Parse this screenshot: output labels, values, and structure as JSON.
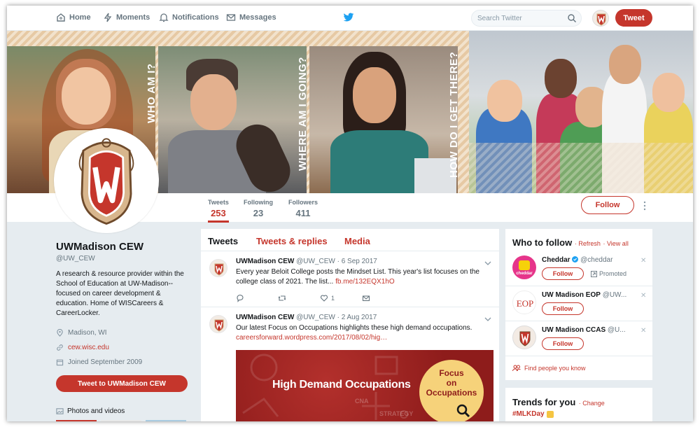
{
  "colors": {
    "accent": "#c5362c",
    "twitter_blue": "#1da1f2",
    "text": "#14171a",
    "muted": "#66757f",
    "background": "#e6ecf0"
  },
  "nav": {
    "items": [
      {
        "label": "Home",
        "icon": "home-icon"
      },
      {
        "label": "Moments",
        "icon": "lightning-icon"
      },
      {
        "label": "Notifications",
        "icon": "bell-icon"
      },
      {
        "label": "Messages",
        "icon": "envelope-icon"
      }
    ],
    "search_placeholder": "Search Twitter",
    "tweet_button": "Tweet"
  },
  "banner": {
    "phrases": [
      "WHO AM I?",
      "WHERE AM I GOING?",
      "HOW DO I GET THERE?"
    ]
  },
  "profile_nav": {
    "stats": [
      {
        "label": "Tweets",
        "value": "253"
      },
      {
        "label": "Following",
        "value": "23"
      },
      {
        "label": "Followers",
        "value": "411"
      }
    ],
    "follow_label": "Follow"
  },
  "profile": {
    "name": "UWMadison CEW",
    "handle": "@UW_CEW",
    "bio": "A research & resource provider within the School of Education at UW-Madison--focused on career development & education. Home of WISCareers & CareerLocker.",
    "location": "Madison, WI",
    "website": "cew.wisc.edu",
    "joined": "Joined September 2009",
    "tweet_to_label": "Tweet to UWMadison CEW",
    "photos_label": "Photos and videos"
  },
  "timeline": {
    "tabs": [
      "Tweets",
      "Tweets & replies",
      "Media"
    ],
    "tweets": [
      {
        "name": "UWMadison CEW",
        "handle_date": "@UW_CEW · 6 Sep 2017",
        "text": "Every year Beloit College posts the Mindset List. This year's list focuses on the college class of 2021. The list...",
        "link": "fb.me/132EQX1hO",
        "likes": "1"
      },
      {
        "name": "UWMadison CEW",
        "handle_date": "@UW_CEW · 2 Aug 2017",
        "text": "Our latest Focus on Occupations highlights these high demand occupations.",
        "link": "careersforward.wordpress.com/2017/08/02/hig…",
        "media_title": "High Demand Occupations",
        "media_badge_line1": "Focus",
        "media_badge_line2": "on",
        "media_badge_line3": "Occupations",
        "media_cna": "CNA",
        "media_strategy": "STRATEGY"
      }
    ]
  },
  "who_to_follow": {
    "title": "Who to follow",
    "refresh": "· Refresh",
    "view_all": "· View all",
    "items": [
      {
        "name": "Cheddar",
        "handle": "@cheddar",
        "promoted": "Promoted",
        "avatar_text": "cheddar"
      },
      {
        "name": "UW Madison EOP",
        "handle": "@UW...",
        "avatar_text": "EOP"
      },
      {
        "name": "UW Madison CCAS",
        "handle": "@U..."
      }
    ],
    "follow_label": "Follow",
    "find_people": "Find people you know"
  },
  "trends": {
    "title": "Trends for you",
    "change": "· Change",
    "first": "#MLKDay"
  }
}
